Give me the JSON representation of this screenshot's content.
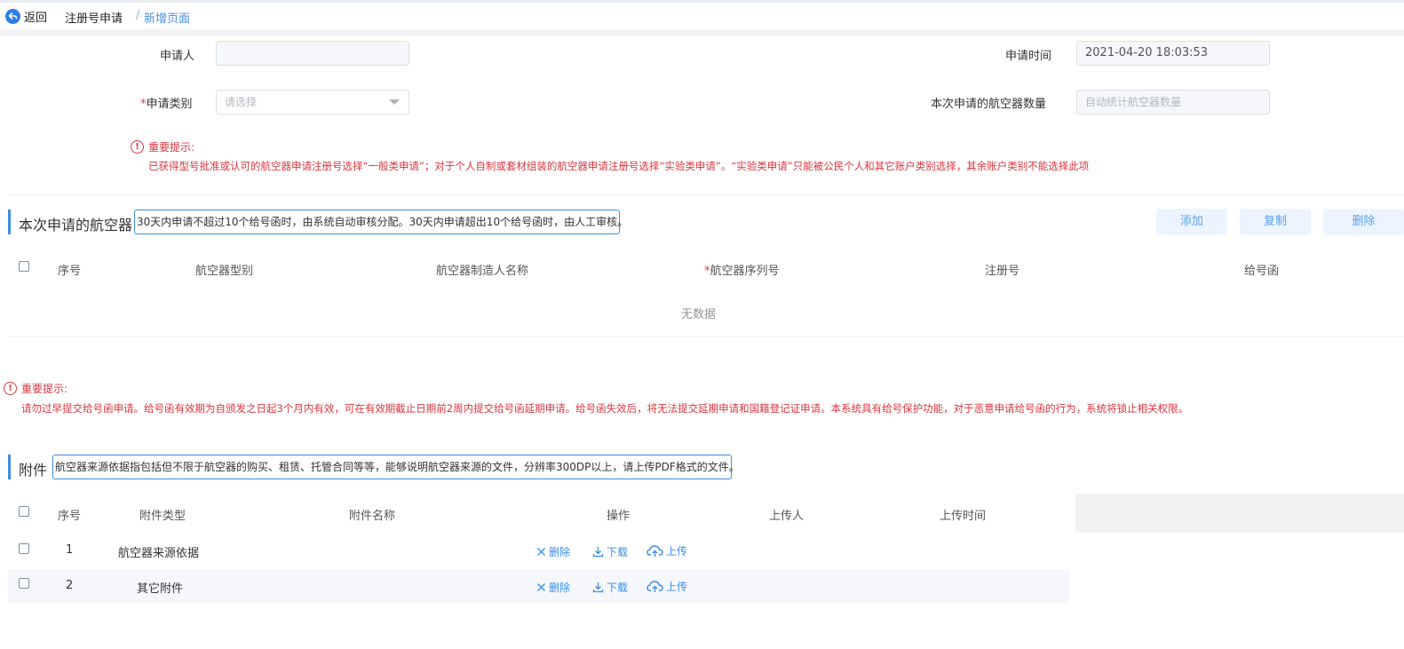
{
  "header": {
    "back_label": "返回",
    "breadcrumb": [
      "注册号申请",
      "新增页面"
    ],
    "separator": "/"
  },
  "form": {
    "applicant_label": "申请人",
    "applicant_value": "",
    "apply_time_label": "申请时间",
    "apply_time_value": "2021-04-20 18:03:53",
    "type_required_mark": "*",
    "type_label": "申请类别",
    "type_placeholder": "请选择",
    "count_label": "本次申请的航空器数量",
    "count_placeholder": "自动统计航空器数量"
  },
  "notice1": {
    "title": "重要提示:",
    "body": "已获得型号批准或认可的航空器申请注册号选择“一般类申请”；对于个人自制或套材组装的航空器申请注册号选择“实验类申请”。“实验类申请”只能被公民个人和其它账户类别选择，其余账户类别不能选择此项"
  },
  "aircraft_section": {
    "title": "本次申请的航空器",
    "tip": "30天内申请不超过10个给号函时，由系统自动审核分配。30天内申请超出10个给号函时，由人工审核。",
    "buttons": {
      "add": "添加",
      "copy": "复制",
      "delete": "删除"
    },
    "columns": {
      "index": "序号",
      "model": "航空器型别",
      "manufacturer": "航空器制造人名称",
      "serial_required_mark": "*",
      "serial": "航空器序列号",
      "reg_no": "注册号",
      "letter": "给号函"
    },
    "empty_text": "无数据"
  },
  "notice2": {
    "title": "重要提示:",
    "body": "请勿过早提交给号函申请。给号函有效期为自颁发之日起3个月内有效，可在有效期截止日期前2周内提交给号函延期申请。给号函失效后，将无法提交延期申请和国籍登记证申请。本系统具有给号保护功能，对于恶意申请给号函的行为，系统将锁止相关权限。"
  },
  "attachment_section": {
    "title": "附件",
    "tip": "航空器来源依据指包括但不限于航空器的购买、租赁、托管合同等等，能够说明航空器来源的文件，分辨率300DP以上，请上传PDF格式的文件。",
    "columns": {
      "index": "序号",
      "type": "附件类型",
      "name": "附件名称",
      "ops": "操作",
      "uploader": "上传人",
      "upload_time": "上传时间"
    },
    "rows": [
      {
        "index": "1",
        "type": "航空器来源依据",
        "delete": "删除",
        "download": "下载",
        "upload": "上传"
      },
      {
        "index": "2",
        "type": "其它附件",
        "delete": "删除",
        "download": "下载",
        "upload": "上传"
      }
    ]
  },
  "colors": {
    "accent": "#3a8ee6",
    "danger": "#d9363e",
    "button_bg": "#ecf5ff"
  },
  "icons": {
    "back": "back-arrow-icon",
    "warning": "warning-circle-icon",
    "delete": "close-icon",
    "download": "download-icon",
    "upload": "cloud-upload-icon",
    "dropdown": "caret-down-icon"
  }
}
